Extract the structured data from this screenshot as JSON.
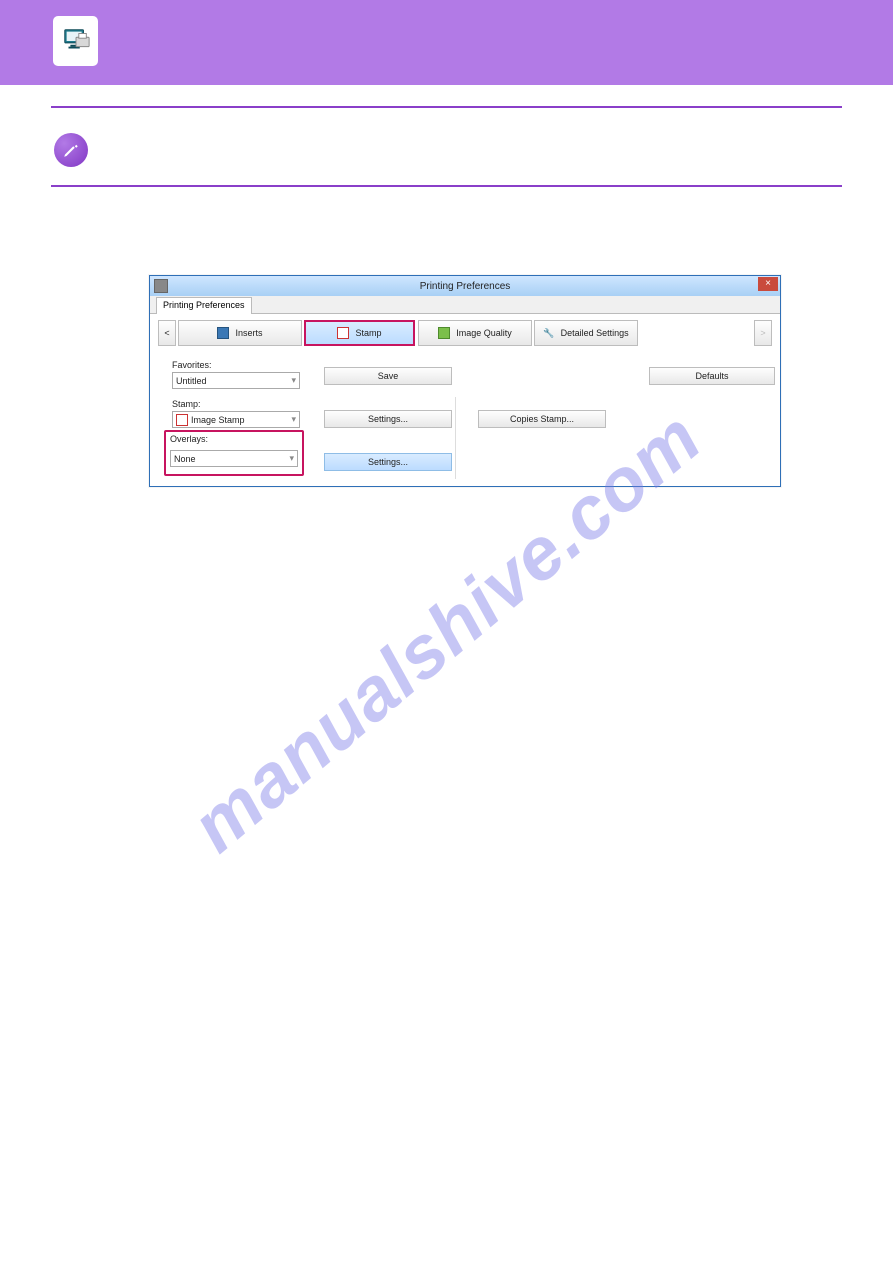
{
  "header": {
    "icon": "printer-monitor-icon"
  },
  "note": {
    "icon": "pencil-circle-icon"
  },
  "dialog": {
    "title": "Printing Preferences",
    "tab": "Printing Preferences",
    "close": "×",
    "tabs": {
      "prev": "<",
      "inserts": "Inserts",
      "stamp": "Stamp",
      "image_quality": "Image Quality",
      "detailed": "Detailed Settings",
      "next": ">"
    },
    "favorites_label": "Favorites:",
    "favorites_value": "Untitled",
    "save_btn": "Save",
    "defaults_btn": "Defaults",
    "stamp_label": "Stamp:",
    "stamp_value": "Image Stamp",
    "settings_btn": "Settings...",
    "copies_stamp_btn": "Copies Stamp...",
    "overlays_label": "Overlays:",
    "overlays_value": "None"
  },
  "watermark": "manualshive.com"
}
